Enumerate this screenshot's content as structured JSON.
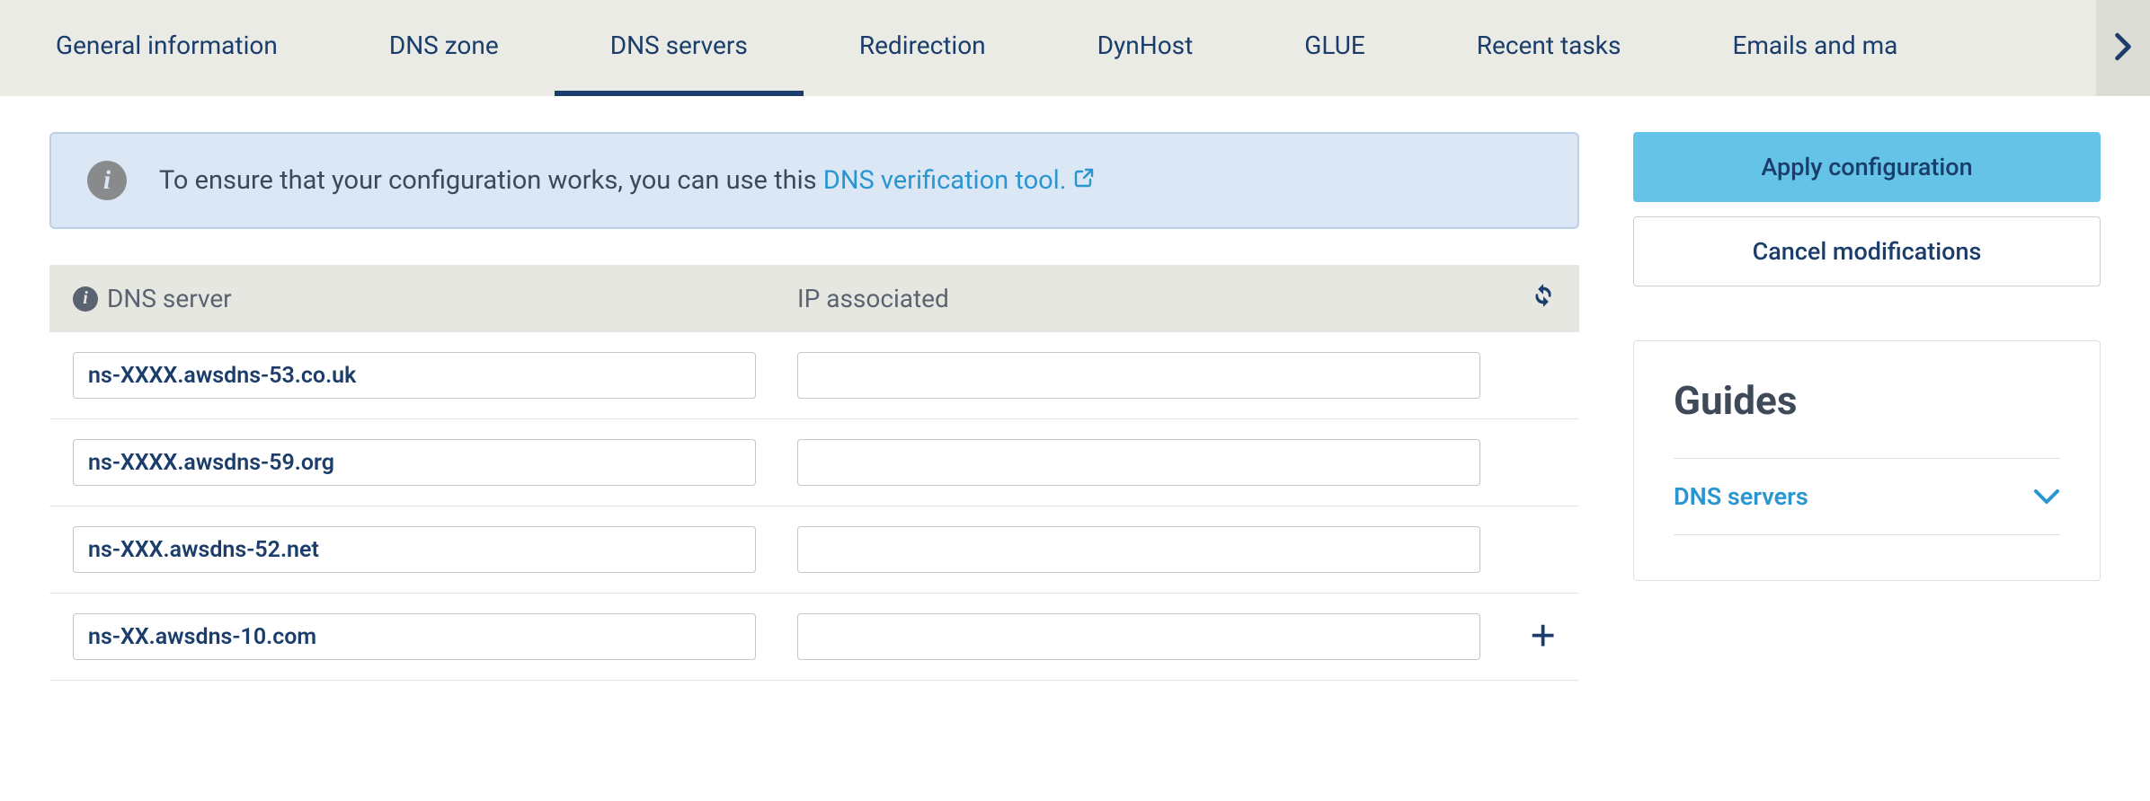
{
  "tabs": {
    "items": [
      {
        "label": "General information"
      },
      {
        "label": "DNS zone"
      },
      {
        "label": "DNS servers"
      },
      {
        "label": "Redirection"
      },
      {
        "label": "DynHost"
      },
      {
        "label": "GLUE"
      },
      {
        "label": "Recent tasks"
      },
      {
        "label": "Emails and ma"
      }
    ],
    "activeIndex": 2
  },
  "banner": {
    "text_prefix": "To ensure that your configuration works, you can use this ",
    "link_text": "DNS verification tool."
  },
  "table": {
    "header_dns": "DNS server",
    "header_ip": "IP associated",
    "rows": [
      {
        "dns": "ns-XXXX.awsdns-53.co.uk",
        "ip": "",
        "add": false
      },
      {
        "dns": "ns-XXXX.awsdns-59.org",
        "ip": "",
        "add": false
      },
      {
        "dns": "ns-XXX.awsdns-52.net",
        "ip": "",
        "add": false
      },
      {
        "dns": "ns-XX.awsdns-10.com",
        "ip": "",
        "add": true
      }
    ]
  },
  "sidebar": {
    "apply_label": "Apply configuration",
    "cancel_label": "Cancel modifications"
  },
  "guides": {
    "title": "Guides",
    "items": [
      {
        "label": "DNS servers"
      }
    ]
  }
}
